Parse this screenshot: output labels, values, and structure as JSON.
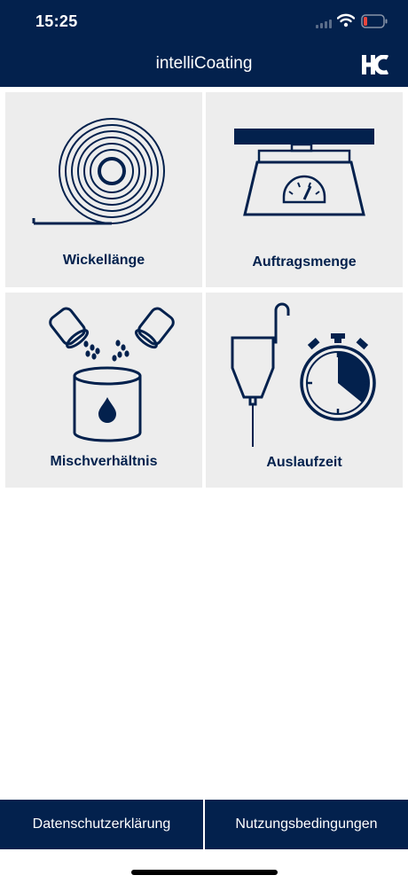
{
  "status_bar": {
    "time": "15:25",
    "icons": [
      "signal-icon",
      "wifi-icon",
      "battery-icon"
    ]
  },
  "header": {
    "title": "intelliCoating",
    "logo_icon": "hc-logo-icon"
  },
  "tiles": [
    {
      "label": "Wickellänge",
      "icon": "roll-icon"
    },
    {
      "label": "Auftragsmenge",
      "icon": "scale-icon"
    },
    {
      "label": "Mischverhältnis",
      "icon": "mixing-cans-icon"
    },
    {
      "label": "Auslaufzeit",
      "icon": "flow-cup-stopwatch-icon"
    }
  ],
  "footer": {
    "privacy_label": "Datenschutzerklärung",
    "terms_label": "Nutzungsbedingungen"
  },
  "colors": {
    "brand": "#03214d",
    "tile_background": "#ededed",
    "battery_low": "#e8453c"
  }
}
